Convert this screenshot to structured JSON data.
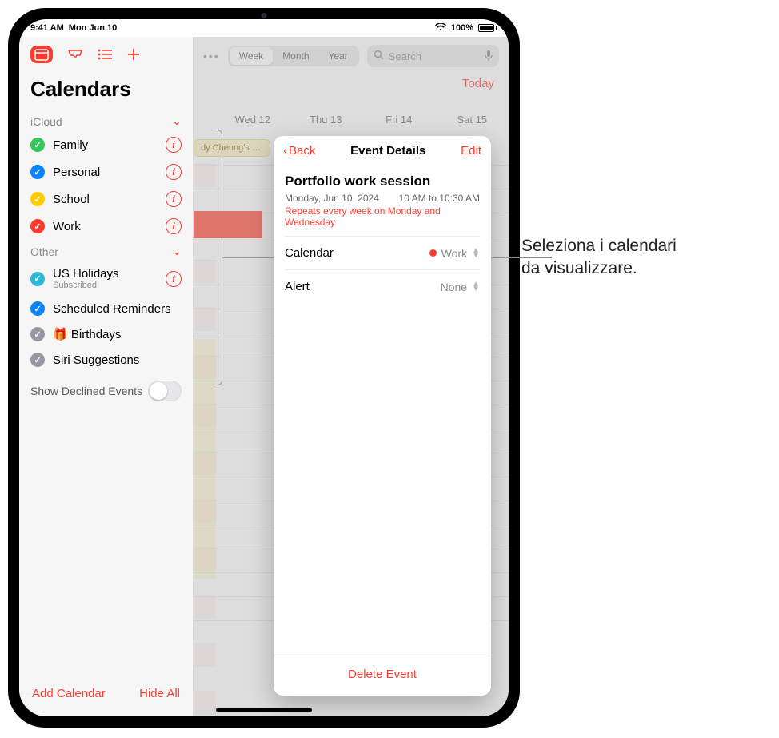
{
  "status": {
    "time": "9:41 AM",
    "date": "Mon Jun 10",
    "battery": "100%",
    "wifi_icon": "wifi",
    "battery_icon": "battery-full"
  },
  "sidebar": {
    "title": "Calendars",
    "sections": [
      {
        "name": "iCloud",
        "items": [
          {
            "label": "Family",
            "color": "#34c759",
            "checked": true,
            "info": true
          },
          {
            "label": "Personal",
            "color": "#0a84ff",
            "checked": true,
            "info": true
          },
          {
            "label": "School",
            "color": "#ffcc00",
            "checked": true,
            "info": true
          },
          {
            "label": "Work",
            "color": "#ff3b30",
            "checked": true,
            "info": true
          }
        ]
      },
      {
        "name": "Other",
        "items": [
          {
            "label": "US Holidays",
            "sub": "Subscribed",
            "color": "#2fb8d6",
            "checked": true,
            "info": true
          },
          {
            "label": "Scheduled Reminders",
            "color": "#0a84ff",
            "checked": true,
            "info": false
          },
          {
            "label": "Birthdays",
            "color": "#9a96a3",
            "checked": true,
            "info": false,
            "icon": "gift"
          },
          {
            "label": "Siri Suggestions",
            "color": "#9a96a3",
            "checked": true,
            "info": false
          }
        ]
      }
    ],
    "declined_label": "Show Declined Events",
    "declined_on": false,
    "footer": {
      "add": "Add Calendar",
      "hide": "Hide All"
    }
  },
  "topbar": {
    "segments": [
      "Week",
      "Month",
      "Year"
    ],
    "search_placeholder": "Search",
    "today": "Today"
  },
  "days": [
    "Wed 12",
    "Thu 13",
    "Fri 14",
    "Sat 15"
  ],
  "peek_event": "dy Cheung's Bi…",
  "event": {
    "back": "Back",
    "header": "Event Details",
    "edit": "Edit",
    "title": "Portfolio work session",
    "date": "Monday, Jun 10, 2024",
    "time": "10 AM to 10:30 AM",
    "repeat": "Repeats every week on Monday and Wednesday",
    "rows": {
      "calendar_label": "Calendar",
      "calendar_value": "Work",
      "alert_label": "Alert",
      "alert_value": "None"
    },
    "delete": "Delete Event"
  },
  "callout": {
    "line1": "Seleziona i calendari",
    "line2": "da visualizzare."
  }
}
